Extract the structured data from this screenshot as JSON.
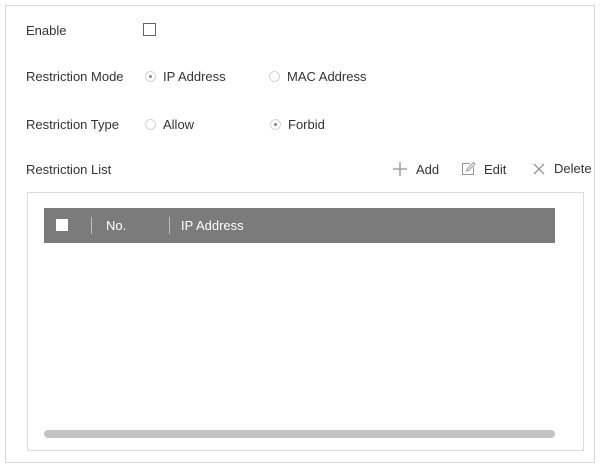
{
  "enable": {
    "label": "Enable",
    "checked": false
  },
  "restriction_mode": {
    "label": "Restriction Mode",
    "options": [
      {
        "label": "IP Address",
        "selected": true
      },
      {
        "label": "MAC Address",
        "selected": false
      }
    ]
  },
  "restriction_type": {
    "label": "Restriction Type",
    "options": [
      {
        "label": "Allow",
        "selected": false
      },
      {
        "label": "Forbid",
        "selected": true
      }
    ]
  },
  "restriction_list": {
    "label": "Restriction List",
    "toolbar": {
      "add_label": "Add",
      "edit_label": "Edit",
      "delete_label": "Delete"
    },
    "table": {
      "columns": [
        "No.",
        "IP Address"
      ],
      "rows": [],
      "scroll_position": 1.0
    }
  },
  "colors": {
    "table_header_bg": "#7b7b7b",
    "radio_selected_dot": "#6a8fb0",
    "panel_border": "#d8d8d8"
  },
  "icons": {
    "add": "plus-icon",
    "edit": "edit-icon",
    "delete": "close-icon"
  }
}
